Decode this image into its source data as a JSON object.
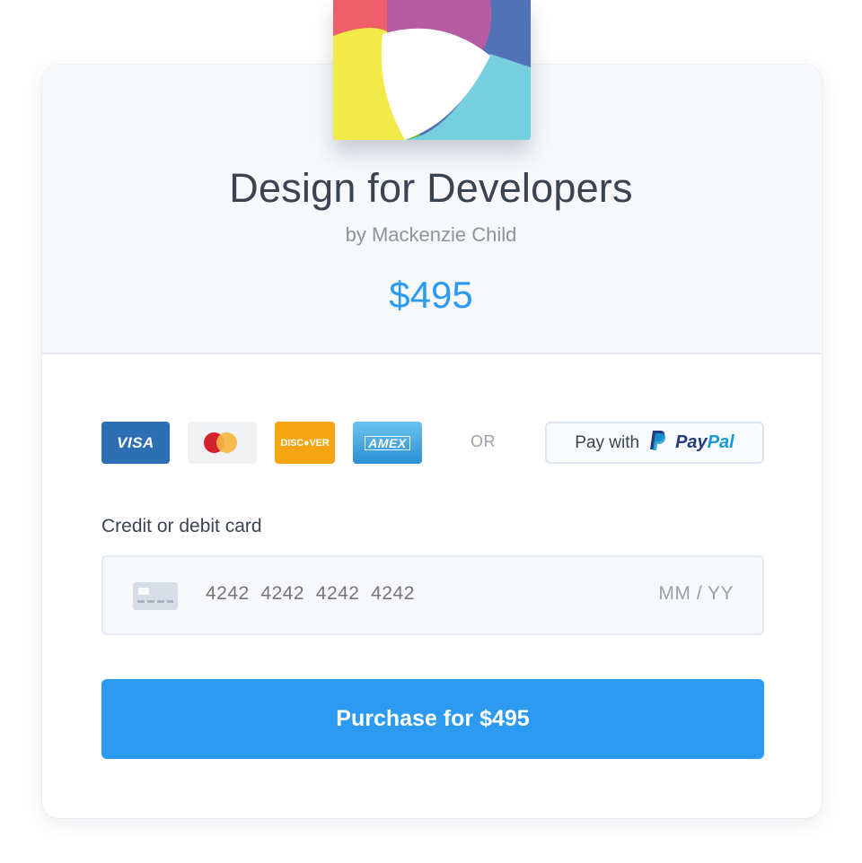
{
  "product": {
    "title": "Design for Developers",
    "author": "by Mackenzie Child",
    "price": "$495",
    "cover_icon": "colorful-book-cover"
  },
  "payment_methods": {
    "visa_label": "VISA",
    "mastercard_icon": "mastercard-circles-icon",
    "discover_label": "DISC●VER",
    "amex_label": "AMEX",
    "or_label": "OR",
    "paypal": {
      "prefix": "Pay with",
      "brand_part1": "Pay",
      "brand_part2": "Pal",
      "icon": "paypal-p-icon"
    }
  },
  "card_form": {
    "label": "Credit or debit card",
    "card_number_placeholder": "4242  4242  4242  4242",
    "expiry_placeholder": "MM  /  YY",
    "card_icon": "credit-card-icon"
  },
  "purchase": {
    "label": "Purchase for $495"
  },
  "colors": {
    "accent": "#2b9af0",
    "visa": "#2d6fb3",
    "discover": "#f7a411",
    "amex": "#2b8fd2",
    "paypal_dark": "#253b80",
    "paypal_light": "#179bd7"
  }
}
